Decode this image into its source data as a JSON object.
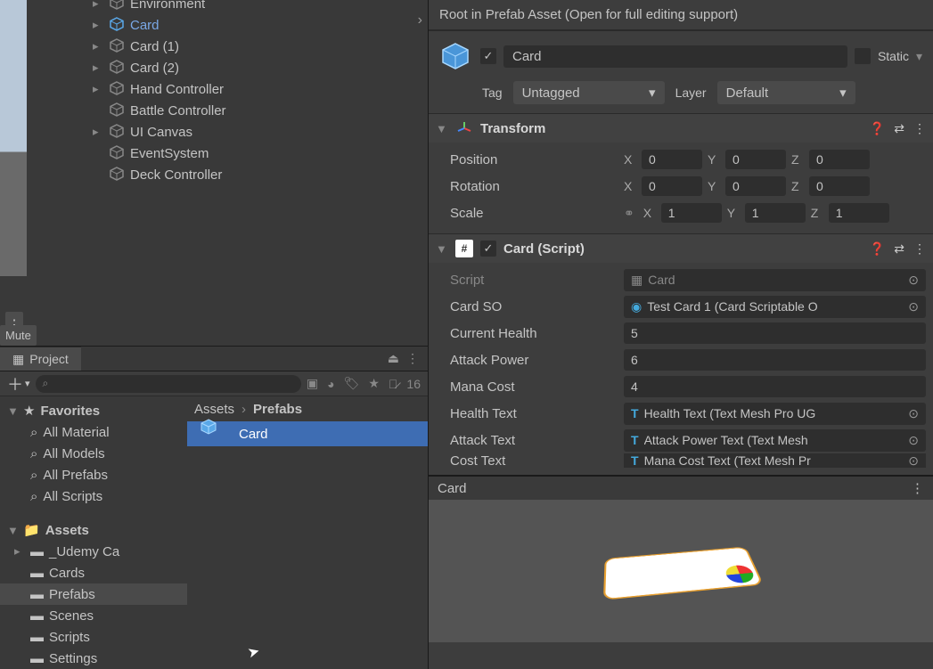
{
  "hierarchy": [
    {
      "label": "Environment",
      "expand": true,
      "sel": false
    },
    {
      "label": "Card",
      "expand": true,
      "sel": true
    },
    {
      "label": "Card (1)",
      "expand": true,
      "sel": false
    },
    {
      "label": "Card (2)",
      "expand": true,
      "sel": false
    },
    {
      "label": "Hand Controller",
      "expand": true,
      "sel": false
    },
    {
      "label": "Battle Controller",
      "expand": false,
      "sel": false
    },
    {
      "label": "UI Canvas",
      "expand": true,
      "sel": false
    },
    {
      "label": "EventSystem",
      "expand": false,
      "sel": false
    },
    {
      "label": "Deck Controller",
      "expand": false,
      "sel": false
    }
  ],
  "mute": "Mute",
  "project": {
    "tab": "Project",
    "search_hint": "",
    "count": "16",
    "favorites_header": "Favorites",
    "favorites": [
      "All Material",
      "All Models",
      "All Prefabs",
      "All Scripts"
    ],
    "assets_header": "Assets",
    "folders": [
      "_Udemy Ca",
      "Cards",
      "Prefabs",
      "Scenes",
      "Scripts",
      "Settings"
    ],
    "selected_folder": "Prefabs",
    "breadcrumb": [
      "Assets",
      "Prefabs"
    ],
    "asset": "Card"
  },
  "inspector": {
    "header": "Root in Prefab Asset (Open for full editing support)",
    "name": "Card",
    "static": "Static",
    "tag_label": "Tag",
    "tag_value": "Untagged",
    "layer_label": "Layer",
    "layer_value": "Default",
    "transform": {
      "title": "Transform",
      "position": {
        "label": "Position",
        "x": "0",
        "y": "0",
        "z": "0"
      },
      "rotation": {
        "label": "Rotation",
        "x": "0",
        "y": "0",
        "z": "0"
      },
      "scale": {
        "label": "Scale",
        "x": "1",
        "y": "1",
        "z": "1"
      }
    },
    "card_script": {
      "title": "Card (Script)",
      "rows": [
        {
          "label": "Script",
          "value": "Card",
          "dim": true,
          "icon": "script"
        },
        {
          "label": "Card SO",
          "value": "Test Card 1 (Card Scriptable O",
          "icon": "so"
        },
        {
          "label": "Current Health",
          "value": "5",
          "num": true
        },
        {
          "label": "Attack Power",
          "value": "6",
          "num": true
        },
        {
          "label": "Mana Cost",
          "value": "4",
          "num": true
        },
        {
          "label": "Health Text",
          "value": "Health Text (Text Mesh Pro UG",
          "icon": "text"
        },
        {
          "label": "Attack Text",
          "value": "Attack Power Text (Text Mesh",
          "icon": "text"
        },
        {
          "label": "Cost Text",
          "value": "Mana Cost Text (Text Mesh Pr",
          "icon": "text",
          "cut": true
        }
      ]
    },
    "preview_title": "Card"
  }
}
